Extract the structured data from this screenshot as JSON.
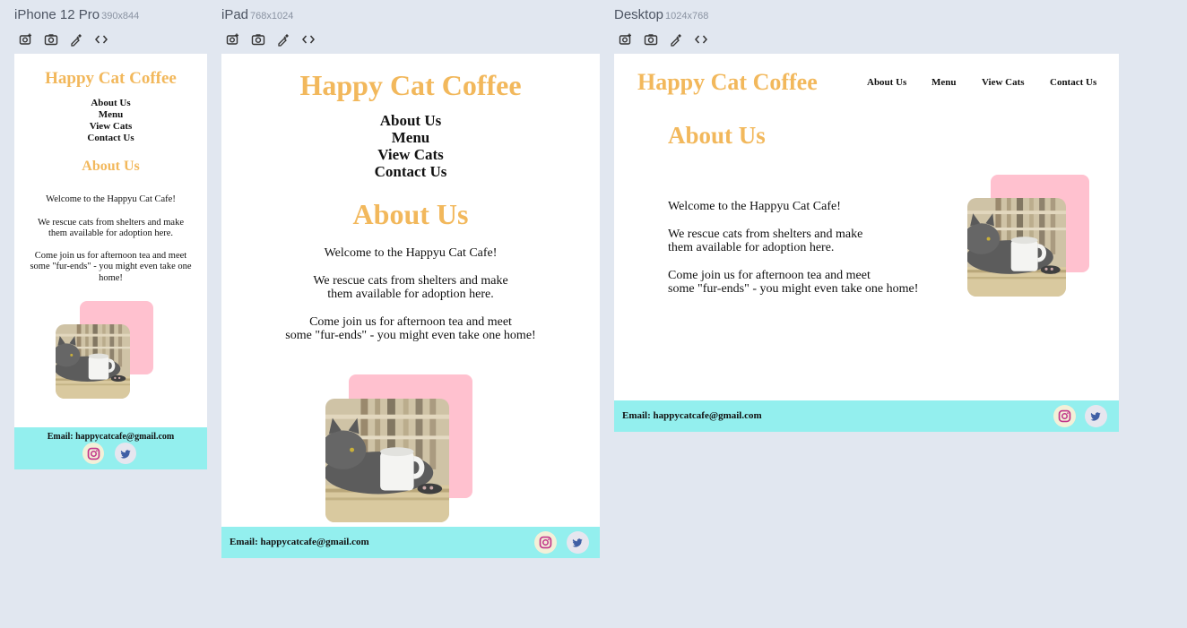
{
  "devices": [
    {
      "name": "iPhone 12 Pro",
      "size": "390x844"
    },
    {
      "name": "iPad",
      "size": "768x1024"
    },
    {
      "name": "Desktop",
      "size": "1024x768"
    }
  ],
  "site": {
    "brand": "Happy Cat Coffee",
    "nav": [
      "About Us",
      "Menu",
      "View Cats",
      "Contact Us"
    ],
    "heading": "About Us",
    "welcome": "Welcome to the Happyu Cat Cafe!",
    "rescue_line1": "We rescue cats from shelters and make",
    "rescue_line2": "them available for adoption here.",
    "join_line1": "Come join us for afternoon tea and meet",
    "join_line2": "some \"fur-ends\" - you might even take one home!",
    "join_mobile_line1": "Come join us for afternoon tea and meet",
    "join_mobile_line2": "some \"fur-ends\" - you might even take one",
    "join_mobile_line3": "home!",
    "email": "Email: happycatcafe@gmail.com"
  },
  "tools": [
    "camera-plus-icon",
    "camera-icon",
    "eyedropper-icon",
    "code-icon"
  ],
  "colors": {
    "brand": "#f2b85c",
    "footer": "#93efee",
    "accent_pink": "#ffc1cf",
    "canvas": "#e1e7f0"
  }
}
